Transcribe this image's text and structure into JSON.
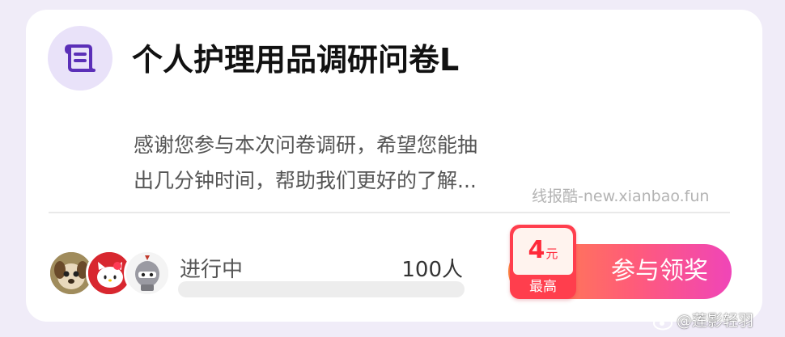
{
  "survey": {
    "title": "个人护理用品调研问卷L",
    "description_line1": "感谢您参与本次问卷调研，希望您能抽",
    "description_line2": "出几分钟时间，帮助我们更好的了解..."
  },
  "status": {
    "label": "进行中",
    "count": "100人",
    "progress_fraction": 0
  },
  "reward": {
    "amount": "4",
    "unit": "元",
    "caption": "最高"
  },
  "cta": {
    "label": "参与领奖"
  },
  "watermark": "线报酷-new.xianbao.fun",
  "weibo_handle": "@莲影轻羽",
  "avatars": [
    "dog-avatar",
    "hello-kitty-avatar",
    "knight-avatar"
  ],
  "colors": {
    "accent_pink": "#ff4e6a",
    "icon_bg": "#e9e2f9",
    "icon_fg": "#5b2fb8",
    "reward_red": "#ff3e4d"
  }
}
